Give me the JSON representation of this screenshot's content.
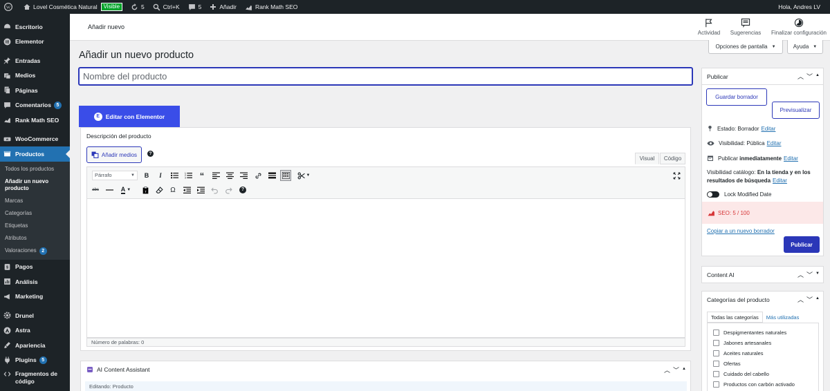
{
  "admin_bar": {
    "site_name": "Lovel Cosmética Natural",
    "visibility_badge": "Visible",
    "updates_count": "5",
    "search_shortcut": "Ctrl+K",
    "comments_count": "5",
    "add_new": "Añadir",
    "rank_math": "Rank Math SEO",
    "greeting": "Hola, Andres LV"
  },
  "sidebar": {
    "items": [
      {
        "label": "Escritorio",
        "icon": "dashboard-icon"
      },
      {
        "label": "Elementor",
        "icon": "elementor-icon"
      },
      {
        "label": "Entradas",
        "icon": "pin-icon"
      },
      {
        "label": "Medios",
        "icon": "media-icon"
      },
      {
        "label": "Páginas",
        "icon": "pages-icon"
      },
      {
        "label": "Comentarios",
        "icon": "comment-icon",
        "badge": "5"
      },
      {
        "label": "Rank Math SEO",
        "icon": "rankmath-icon"
      },
      {
        "label": "WooCommerce",
        "icon": "woocommerce-icon"
      },
      {
        "label": "Productos",
        "icon": "products-icon"
      },
      {
        "label": "Pagos",
        "icon": "payments-icon"
      },
      {
        "label": "Análisis",
        "icon": "analytics-icon"
      },
      {
        "label": "Marketing",
        "icon": "marketing-icon"
      },
      {
        "label": "Drunel",
        "icon": "gear-icon"
      },
      {
        "label": "Astra",
        "icon": "astra-icon"
      },
      {
        "label": "Apariencia",
        "icon": "brush-icon"
      },
      {
        "label": "Plugins",
        "icon": "plugin-icon",
        "badge": "5"
      },
      {
        "label": "Fragmentos de código",
        "icon": "code-icon"
      }
    ],
    "products_submenu": {
      "all": "Todos los productos",
      "add_new": "Añadir un nuevo producto",
      "brands": "Marcas",
      "categories": "Categorías",
      "tags": "Etiquetas",
      "attributes": "Atributos",
      "reviews": "Valoraciones",
      "reviews_badge": "2"
    }
  },
  "header": {
    "page_title": "Añadir nuevo",
    "activity": "Actividad",
    "suggestions": "Sugerencias",
    "finish_setup": "Finalizar configuración"
  },
  "screen_options": "Opciones de pantalla",
  "help": "Ayuda",
  "main": {
    "title": "Añadir un nuevo producto",
    "name_placeholder": "Nombre del producto",
    "elementor_button": "Editar con Elementor",
    "description_title": "Descripción del producto",
    "add_media": "Añadir medios",
    "tab_visual": "Visual",
    "tab_code": "Código",
    "format_select": "Párrafo",
    "word_count": "Número de palabras: 0"
  },
  "ai_card": {
    "title": "AI Content Assistant",
    "editing": "Editando: Producto"
  },
  "publish": {
    "title": "Publicar",
    "save_draft": "Guardar borrador",
    "preview": "Previsualizar",
    "status_label": "Estado:",
    "status_value": "Borrador",
    "visibility_label": "Visibilidad:",
    "visibility_value": "Pública",
    "publish_label": "Publicar",
    "publish_value": "inmediatamente",
    "edit": "Editar",
    "catalog_label": "Visibilidad catálogo:",
    "catalog_value": "En la tienda y en los resultados de búsqueda",
    "lock_modified": "Lock Modified Date",
    "seo_score": "SEO: 5 / 100",
    "copy_draft": "Copiar a un nuevo borrador",
    "publish_button": "Publicar"
  },
  "content_ai": {
    "title": "Content AI"
  },
  "categories": {
    "title": "Categorías del producto",
    "tab_all": "Todas las categorías",
    "tab_used": "Más utilizadas",
    "items": [
      "Despigmentantes naturales",
      "Jabones artesanales",
      "Aceites naturales",
      "Ofertas",
      "Cuidado del cabello",
      "Productos con carbón activado"
    ]
  },
  "colors": {
    "admin_dark": "#1d2327",
    "active_blue": "#2271b1",
    "primary_blue": "#2b37b8",
    "elementor_blue": "#3a4de8",
    "seo_red": "#d63638"
  }
}
